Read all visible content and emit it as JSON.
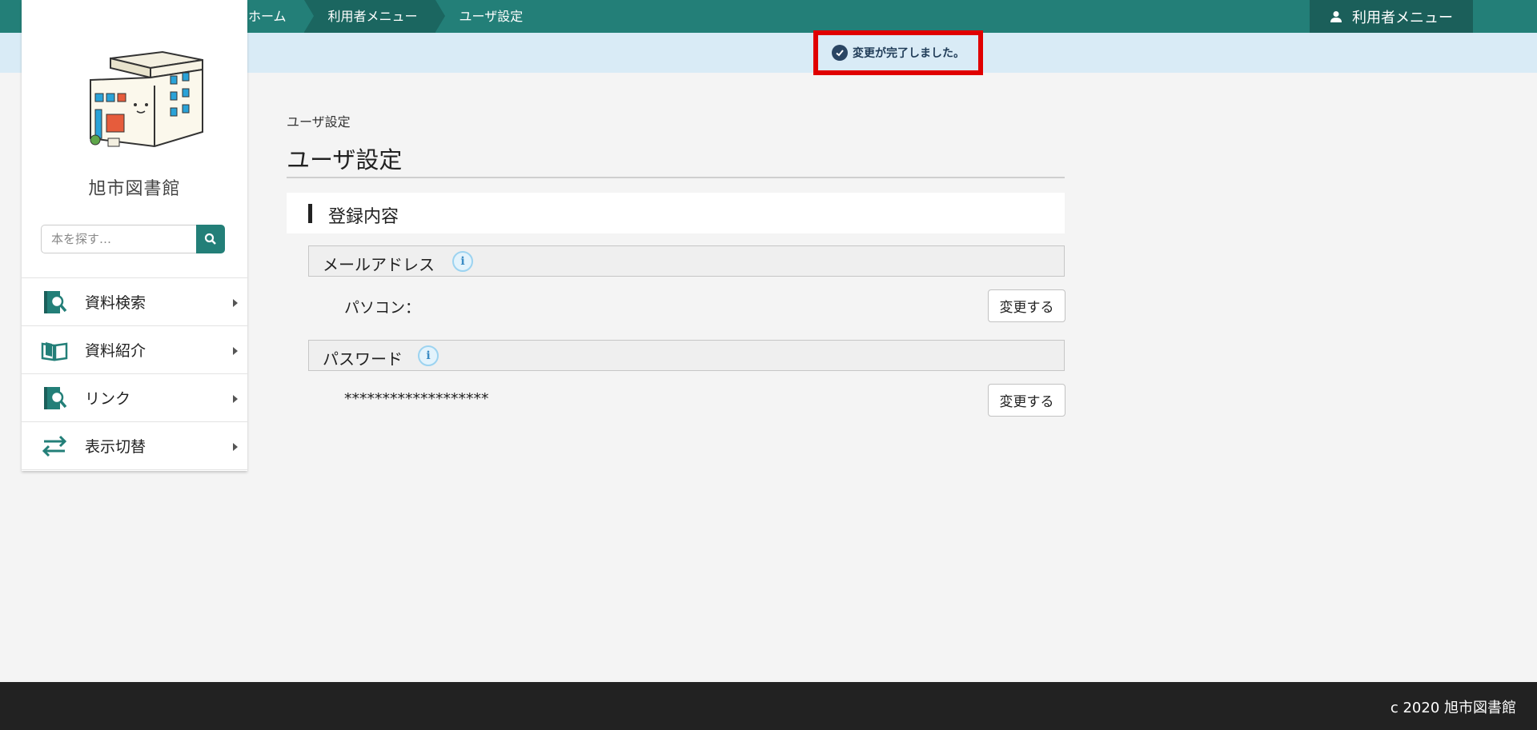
{
  "header": {
    "breadcrumb": [
      {
        "label": "ホーム"
      },
      {
        "label": "利用者メニュー"
      },
      {
        "label": "ユーザ設定"
      }
    ],
    "user_menu_label": "利用者メニュー",
    "user_menu_icon": "user-icon",
    "bar_color": "#237f78"
  },
  "notice": {
    "message": "変更が完了しました。",
    "icon": "check-circle-icon",
    "highlight_color": "#e00000"
  },
  "sidebar": {
    "library_name": "旭市図書館",
    "search": {
      "placeholder": "本を探す…",
      "icon": "search-icon"
    },
    "items": [
      {
        "label": "資料検索",
        "icon": "book-search-icon"
      },
      {
        "label": "資料紹介",
        "icon": "open-book-icon"
      },
      {
        "label": "リンク",
        "icon": "link-search-icon"
      },
      {
        "label": "表示切替",
        "icon": "swap-arrows-icon"
      }
    ]
  },
  "main": {
    "breadcrumb_label": "ユーザ設定",
    "title": "ユーザ設定",
    "section_title": "登録内容",
    "fields": [
      {
        "header": "メールアドレス",
        "info_icon": "info-icon",
        "row_label": "パソコン：",
        "button_label": "変更する"
      },
      {
        "header": "パスワード",
        "info_icon": "info-icon",
        "row_label": "*******************",
        "button_label": "変更する"
      }
    ]
  },
  "footer": {
    "copyright": "c 2020 旭市図書館"
  }
}
